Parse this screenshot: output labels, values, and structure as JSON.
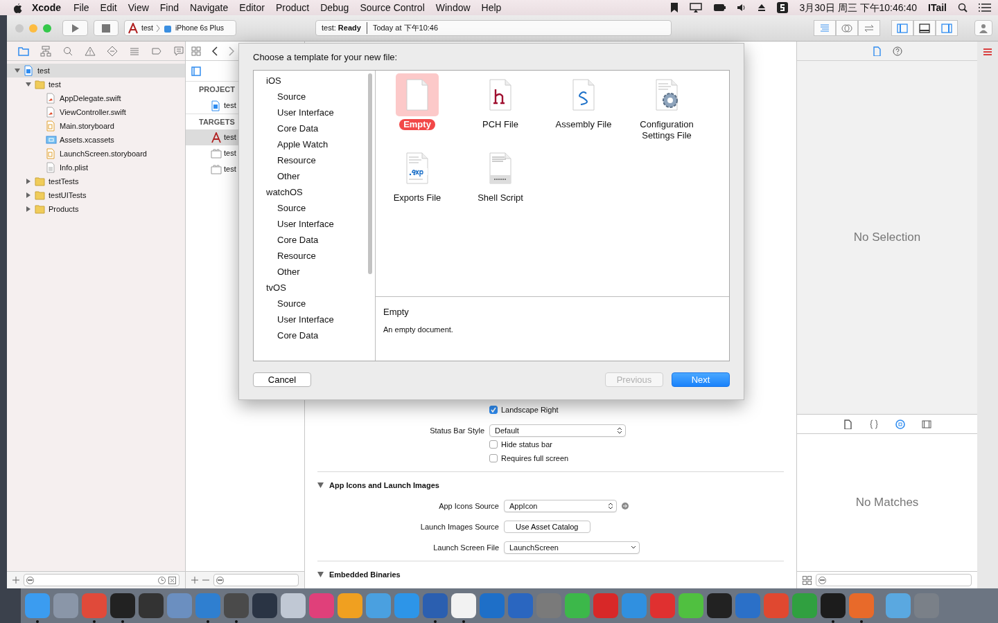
{
  "menubar": {
    "app_name": "Xcode",
    "menus": [
      "File",
      "Edit",
      "View",
      "Find",
      "Navigate",
      "Editor",
      "Product",
      "Debug",
      "Source Control",
      "Window",
      "Help"
    ],
    "date_time": "3月30日 周三 下午10:46:40",
    "user": "ITail"
  },
  "toolbar": {
    "scheme": "test",
    "device": "iPhone 6s Plus",
    "status": "test: **Ready**",
    "status_time": "Today at 下午10:46"
  },
  "navigator": {
    "tree": [
      {
        "name": "test",
        "kind": "project",
        "expanded": true,
        "selected": true,
        "children": [
          {
            "name": "test",
            "kind": "folder",
            "expanded": true,
            "selected": false,
            "children": [
              {
                "name": "AppDelegate.swift",
                "kind": "swift",
                "selected": false
              },
              {
                "name": "ViewController.swift",
                "kind": "swift",
                "selected": false
              },
              {
                "name": "Main.storyboard",
                "kind": "storyboard",
                "selected": false
              },
              {
                "name": "Assets.xcassets",
                "kind": "assets",
                "selected": false
              },
              {
                "name": "LaunchScreen.storyboard",
                "kind": "storyboard",
                "selected": false
              },
              {
                "name": "Info.plist",
                "kind": "plist",
                "selected": false
              }
            ]
          },
          {
            "name": "testTests",
            "kind": "folder",
            "expanded": false,
            "selected": false
          },
          {
            "name": "testUITests",
            "kind": "folder",
            "expanded": false,
            "selected": false
          },
          {
            "name": "Products",
            "kind": "folder",
            "expanded": false,
            "selected": false
          }
        ]
      }
    ]
  },
  "project_list": {
    "sections": [
      {
        "title": "PROJECT",
        "items": [
          {
            "name": "test",
            "kind": "project",
            "selected": false
          }
        ]
      },
      {
        "title": "TARGETS",
        "items": [
          {
            "name": "test",
            "kind": "app",
            "selected": true
          },
          {
            "name": "test",
            "kind": "bundle",
            "selected": false
          },
          {
            "name": "test",
            "kind": "bundle",
            "selected": false
          }
        ]
      }
    ]
  },
  "dialog": {
    "title": "Choose a template for your new file:",
    "platforms": [
      {
        "name": "iOS",
        "categories": [
          {
            "name": "Source",
            "selected": false
          },
          {
            "name": "User Interface",
            "selected": false
          },
          {
            "name": "Core Data",
            "selected": false
          },
          {
            "name": "Apple Watch",
            "selected": false
          },
          {
            "name": "Resource",
            "selected": false
          },
          {
            "name": "Other",
            "selected": false
          }
        ]
      },
      {
        "name": "watchOS",
        "categories": [
          {
            "name": "Source",
            "selected": false
          },
          {
            "name": "User Interface",
            "selected": false
          },
          {
            "name": "Core Data",
            "selected": false
          },
          {
            "name": "Resource",
            "selected": false
          },
          {
            "name": "Other",
            "selected": false
          }
        ]
      },
      {
        "name": "tvOS",
        "categories": [
          {
            "name": "Source",
            "selected": false
          },
          {
            "name": "User Interface",
            "selected": false
          },
          {
            "name": "Core Data",
            "selected": false
          }
        ]
      }
    ],
    "templates": [
      {
        "name": "Empty",
        "kind": "blank",
        "selected": true
      },
      {
        "name": "PCH File",
        "kind": "pch",
        "selected": false
      },
      {
        "name": "Assembly File",
        "kind": "asm",
        "selected": false
      },
      {
        "name": "Configuration Settings File",
        "kind": "config",
        "selected": false
      },
      {
        "name": "Exports File",
        "kind": "exp",
        "selected": false
      },
      {
        "name": "Shell Script",
        "kind": "shell",
        "selected": false
      }
    ],
    "description": {
      "title": "Empty",
      "text": "An empty document."
    },
    "buttons": [
      {
        "label": "Cancel",
        "kind": "normal",
        "disabled": false
      },
      {
        "label": "Previous",
        "kind": "normal",
        "disabled": true
      },
      {
        "label": "Next",
        "kind": "default",
        "disabled": false
      }
    ]
  },
  "editor": {
    "rows": [
      {
        "kind": "checkbox",
        "label": "Landscape Right",
        "checked": true
      },
      {
        "kind": "select",
        "label": "Status Bar Style",
        "value": "Default"
      },
      {
        "kind": "checkbox",
        "label": "Hide status bar",
        "checked": false
      },
      {
        "kind": "checkbox",
        "label": "Requires full screen",
        "checked": false
      },
      {
        "kind": "section",
        "title": "App Icons and Launch Images",
        "expanded": true
      },
      {
        "kind": "select",
        "label": "App Icons Source",
        "value": "AppIcon",
        "link": true
      },
      {
        "kind": "button",
        "label": "Launch Images Source",
        "value": "Use Asset Catalog"
      },
      {
        "kind": "combo",
        "label": "Launch Screen File",
        "value": "LaunchScreen"
      },
      {
        "kind": "section",
        "title": "Embedded Binaries",
        "expanded": true
      }
    ]
  },
  "inspector": {
    "tabs": [
      {
        "kind": "file",
        "selected": true
      },
      {
        "kind": "help",
        "selected": false
      }
    ],
    "empty_text": "No Selection",
    "library_tabs": [
      {
        "kind": "file",
        "selected": false
      },
      {
        "kind": "braces",
        "selected": false
      },
      {
        "kind": "object",
        "selected": true
      },
      {
        "kind": "media",
        "selected": false
      }
    ],
    "library_empty": "No Matches"
  },
  "dock": [
    {
      "color": "#3b9cf0",
      "running": true
    },
    {
      "color": "#8a96a8",
      "running": false
    },
    {
      "color": "#e04a3a",
      "running": true
    },
    {
      "color": "#222222",
      "running": true
    },
    {
      "color": "#333333",
      "running": false
    },
    {
      "color": "#6b8fc0",
      "running": false
    },
    {
      "color": "#2f7fd0",
      "running": true
    },
    {
      "color": "#4a4a4a",
      "running": true
    },
    {
      "color": "#2a3444",
      "running": false
    },
    {
      "color": "#c0c8d4",
      "running": false
    },
    {
      "color": "#e0407a",
      "running": false
    },
    {
      "color": "#f0a020",
      "running": false
    },
    {
      "color": "#4aa0e0",
      "running": false
    },
    {
      "color": "#2d95e8",
      "running": false
    },
    {
      "color": "#2b5fb0",
      "running": true
    },
    {
      "color": "#f2f2f2",
      "running": true
    },
    {
      "color": "#1e6fc8",
      "running": false
    },
    {
      "color": "#2a66c0",
      "running": false
    },
    {
      "color": "#7a7a7a",
      "running": false
    },
    {
      "color": "#3cb84a",
      "running": false
    },
    {
      "color": "#d82828",
      "running": false
    },
    {
      "color": "#3090e0",
      "running": false
    },
    {
      "color": "#e03030",
      "running": false
    },
    {
      "color": "#50c040",
      "running": false
    },
    {
      "color": "#222222",
      "running": false
    },
    {
      "color": "#2b70c8",
      "running": false
    },
    {
      "color": "#e04830",
      "running": false
    },
    {
      "color": "#30a040",
      "running": false
    },
    {
      "color": "#1c1c1c",
      "running": true
    },
    {
      "color": "#e86a2a",
      "running": true
    },
    {
      "color": "#5aa8e0",
      "running": false
    },
    {
      "color": "#7a8088",
      "running": false
    }
  ]
}
